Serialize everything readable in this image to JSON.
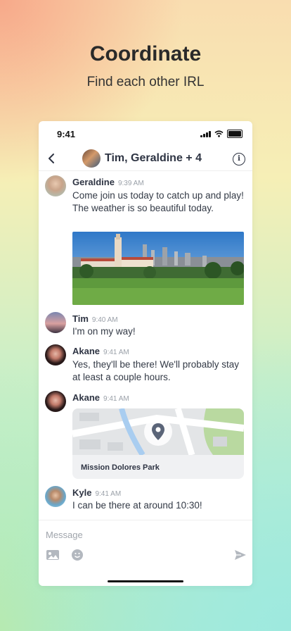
{
  "promo": {
    "title": "Coordinate",
    "subtitle": "Find each other IRL"
  },
  "status_bar": {
    "time": "9:41"
  },
  "header": {
    "title": "Tim, Geraldine + 4"
  },
  "messages": [
    {
      "sender": "Geraldine",
      "time": "9:39 AM",
      "text": "Come join us today to catch up and play! The weather is so beautiful today."
    },
    {
      "sender": "Tim",
      "time": "9:40 AM",
      "text": "I'm on my way!"
    },
    {
      "sender": "Akane",
      "time": "9:41 AM",
      "text": "Yes, they'll be there! We'll probably stay at least a couple hours."
    },
    {
      "sender": "Akane",
      "time": "9:41 AM",
      "location": "Mission Dolores Park"
    },
    {
      "sender": "Kyle",
      "time": "9:41 AM",
      "text": "I can be there at around 10:30!"
    }
  ],
  "composer": {
    "placeholder": "Message"
  },
  "icons": [
    "chevron-left-icon",
    "info-icon",
    "image-icon",
    "emoji-icon",
    "send-icon",
    "location-pin-icon"
  ],
  "colors": {
    "text_dark": "#2e3443",
    "muted": "#9aa0a8"
  }
}
